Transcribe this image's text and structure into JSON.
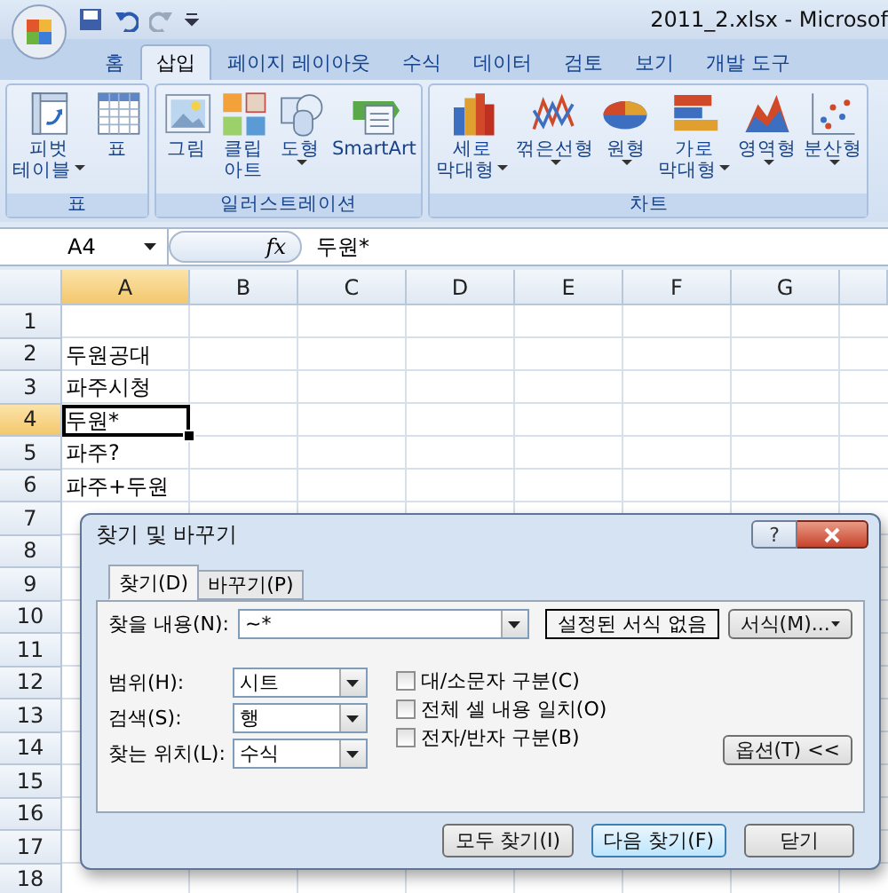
{
  "window": {
    "title": "2011_2.xlsx - Microsof"
  },
  "tabs": [
    {
      "label": "홈",
      "selected": false
    },
    {
      "label": "삽입",
      "selected": true
    },
    {
      "label": "페이지 레이아웃",
      "selected": false
    },
    {
      "label": "수식",
      "selected": false
    },
    {
      "label": "데이터",
      "selected": false
    },
    {
      "label": "검토",
      "selected": false
    },
    {
      "label": "보기",
      "selected": false
    },
    {
      "label": "개발 도구",
      "selected": false
    }
  ],
  "ribbon_groups": [
    {
      "label": "표",
      "buttons": [
        {
          "kind": "pivot",
          "lines": [
            "피벗",
            "테이블"
          ],
          "dropdown": true
        },
        {
          "kind": "table",
          "lines": [
            "표"
          ],
          "dropdown": false
        }
      ]
    },
    {
      "label": "일러스트레이션",
      "buttons": [
        {
          "kind": "picture",
          "lines": [
            "그림"
          ],
          "dropdown": false
        },
        {
          "kind": "clipart",
          "lines": [
            "클립",
            "아트"
          ],
          "dropdown": false
        },
        {
          "kind": "shapes",
          "lines": [
            "도형"
          ],
          "dropdown": true
        },
        {
          "kind": "smartart",
          "lines": [
            "SmartArt"
          ],
          "dropdown": false
        }
      ]
    },
    {
      "label": "차트",
      "buttons": [
        {
          "kind": "column",
          "lines": [
            "세로",
            "막대형"
          ],
          "dropdown": true
        },
        {
          "kind": "line",
          "lines": [
            "꺾은선형"
          ],
          "dropdown": true
        },
        {
          "kind": "pie",
          "lines": [
            "원형"
          ],
          "dropdown": true
        },
        {
          "kind": "bar",
          "lines": [
            "가로",
            "막대형"
          ],
          "dropdown": true
        },
        {
          "kind": "area",
          "lines": [
            "영역형"
          ],
          "dropdown": true
        },
        {
          "kind": "scatter",
          "lines": [
            "분산형"
          ],
          "dropdown": true
        }
      ]
    }
  ],
  "formula_bar": {
    "name_box": "A4",
    "function_label": "fx",
    "formula": "두원*"
  },
  "sheet": {
    "columns": [
      {
        "label": "A",
        "selected": true
      },
      {
        "label": "B",
        "selected": false
      },
      {
        "label": "C",
        "selected": false
      },
      {
        "label": "D",
        "selected": false
      },
      {
        "label": "E",
        "selected": false
      },
      {
        "label": "F",
        "selected": false
      },
      {
        "label": "G",
        "selected": false
      }
    ],
    "rows": [
      {
        "header": "1",
        "selected": false
      },
      {
        "header": "2",
        "value": "두원공대",
        "selected": false
      },
      {
        "header": "3",
        "value": "파주시청",
        "selected": false
      },
      {
        "header": "4",
        "value": "두원*",
        "selected": true
      },
      {
        "header": "5",
        "value": "파주?",
        "selected": false
      },
      {
        "header": "6",
        "value": "파주+두원",
        "selected": false
      },
      {
        "header": "7",
        "selected": false
      },
      {
        "header": "8",
        "selected": false
      },
      {
        "header": "9",
        "selected": false
      },
      {
        "header": "10",
        "selected": false
      },
      {
        "header": "11",
        "selected": false
      },
      {
        "header": "12",
        "selected": false
      },
      {
        "header": "13",
        "selected": false
      },
      {
        "header": "14",
        "selected": false
      },
      {
        "header": "15",
        "selected": false
      },
      {
        "header": "16",
        "selected": false
      },
      {
        "header": "17",
        "selected": false
      },
      {
        "header": "18",
        "selected": false
      }
    ]
  },
  "dialog": {
    "title": "찾기 및 바꾸기",
    "help_button": "?",
    "tabs": [
      {
        "label": "찾기(D)",
        "selected": true
      },
      {
        "label": "바꾸기(P)",
        "selected": false
      }
    ],
    "find_label": "찾을 내용(N):",
    "find_value": "~*",
    "format_preview": "설정된 서식 없음",
    "format_button": "서식(M)...",
    "selects": [
      {
        "label": "범위(H):",
        "value": "시트"
      },
      {
        "label": "검색(S):",
        "value": "행"
      },
      {
        "label": "찾는 위치(L):",
        "value": "수식"
      }
    ],
    "checkboxes": [
      {
        "label": "대/소문자 구분(C)",
        "checked": false
      },
      {
        "label": "전체 셀 내용 일치(O)",
        "checked": false
      },
      {
        "label": "전자/반자 구분(B)",
        "checked": false
      }
    ],
    "options_button": "옵션(T) <<",
    "buttons": [
      {
        "label": "모두 찾기(I)",
        "default": false
      },
      {
        "label": "다음 찾기(F)",
        "default": true
      },
      {
        "label": "닫기",
        "default": false
      }
    ]
  }
}
